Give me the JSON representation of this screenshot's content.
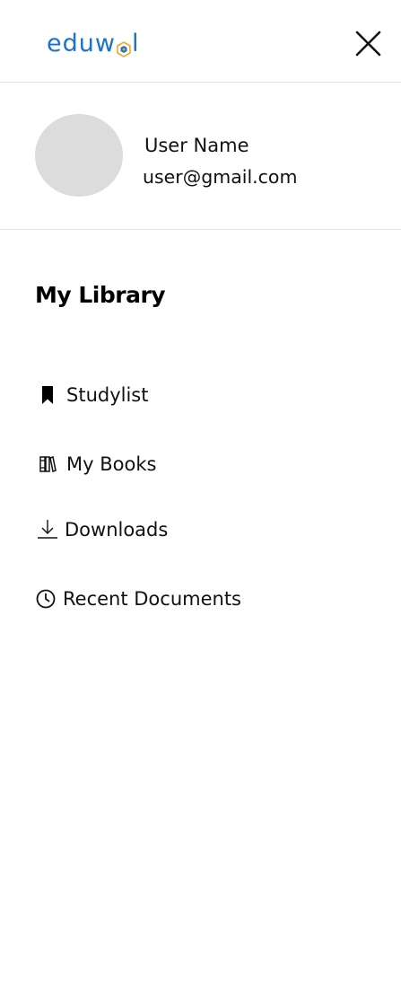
{
  "header": {
    "logo_text_left": "eduw",
    "logo_text_right": "l",
    "logo_icon": "hexagon-logo-icon",
    "close_icon": "close-icon",
    "brand_color": "#1a73c9"
  },
  "profile": {
    "name": "User Name",
    "email": "user@gmail.com",
    "avatar_color": "#dcdcdc"
  },
  "library": {
    "title": "My Library",
    "items": [
      {
        "label": "Studylist",
        "icon": "bookmark-icon"
      },
      {
        "label": "My Books",
        "icon": "books-icon"
      },
      {
        "label": "Downloads",
        "icon": "download-icon"
      },
      {
        "label": "Recent Documents",
        "icon": "clock-icon"
      }
    ]
  }
}
